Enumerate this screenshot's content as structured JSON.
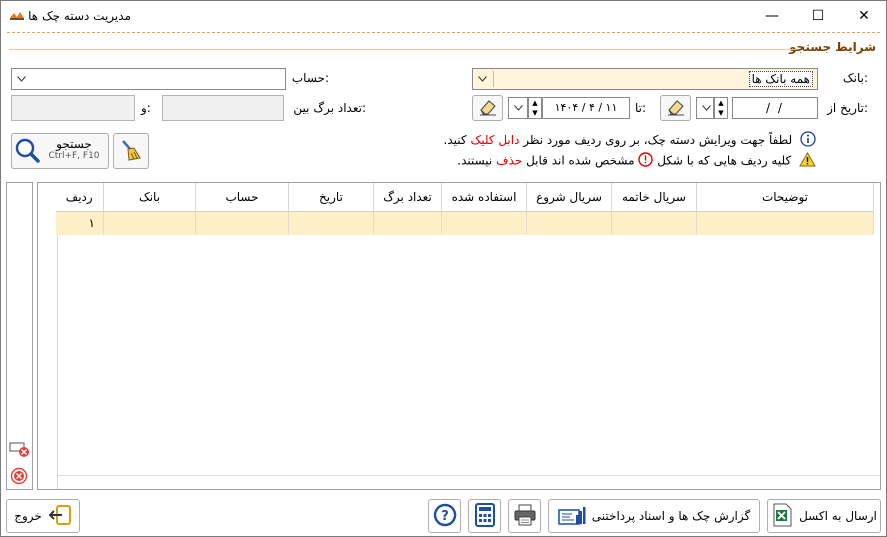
{
  "window": {
    "title": "مدیریت دسته چک ها",
    "minimize_glyph": "—",
    "maximize_glyph": "☐",
    "close_glyph": "✕"
  },
  "search": {
    "section_title": "شرایط جستجو",
    "bank_label": "بانک:",
    "bank_value": "همه بانک ها",
    "account_label": "حساب:",
    "account_value": "",
    "date_from_label": "تاریخ از:",
    "date_from_value": "/      /",
    "date_to_label": "تا:",
    "date_to_value": "۱۴۰۴  /  ۴  /  ۱۱",
    "leaf_count_label": "تعداد برگ بین:",
    "and_label": "و:",
    "search_button_label": "جستجو",
    "search_button_shortcut": "Ctrl+F, F10"
  },
  "info": {
    "line1_prefix": "لطفاً جهت ویرایش دسته چک، بر روی ردیف مورد نظر",
    "line1_highlight": "دابل کلیک",
    "line1_suffix": "کنید.",
    "line2_prefix": "کلیه ردیف هایی که با شکل",
    "line2_middle": "مشخص شده اند قابل",
    "line2_highlight": "حذف",
    "line2_suffix": "نیستند.",
    "colors": {
      "highlight": "#e00000",
      "info_icon": "#1a3d8f",
      "warning_icon": "#d4a017"
    }
  },
  "table": {
    "columns": [
      "ردیف",
      "بانک",
      "حساب",
      "تاریخ",
      "تعداد برگ",
      "استفاده شده",
      "سریال شروع",
      "سریال خاتمه",
      "توضیحات"
    ],
    "rows": [
      [
        "۱",
        "",
        "",
        "",
        "",
        "",
        "",
        "",
        ""
      ]
    ],
    "row_highlight_color": "#fdf0c8"
  },
  "footer": {
    "exit_label": "خروج",
    "excel_label": "ارسال به اکسل",
    "report_label": "گزارش چک ها و اسناد پرداختنی"
  }
}
